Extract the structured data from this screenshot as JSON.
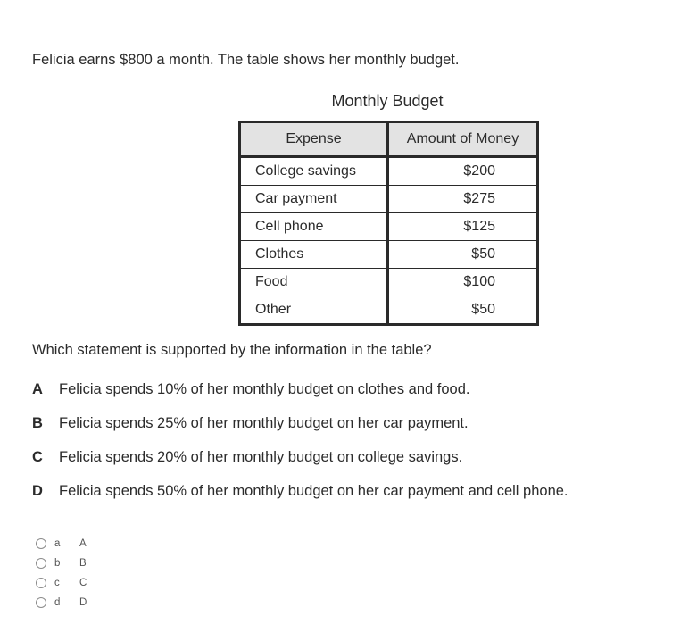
{
  "intro": "Felicia earns $800 a month. The table shows her monthly budget.",
  "table": {
    "title": "Monthly Budget",
    "headers": {
      "expense": "Expense",
      "amount": "Amount of Money"
    },
    "rows": [
      {
        "expense": "College savings",
        "amount": "$200"
      },
      {
        "expense": "Car payment",
        "amount": "$275"
      },
      {
        "expense": "Cell phone",
        "amount": "$125"
      },
      {
        "expense": "Clothes",
        "amount": "$50"
      },
      {
        "expense": "Food",
        "amount": "$100"
      },
      {
        "expense": "Other",
        "amount": "$50"
      }
    ]
  },
  "question": "Which statement is supported by the information in the table?",
  "choices": [
    {
      "letter": "A",
      "text": "Felicia spends 10% of her monthly budget on clothes and food."
    },
    {
      "letter": "B",
      "text": "Felicia spends 25% of her monthly budget on her car payment."
    },
    {
      "letter": "C",
      "text": "Felicia spends 20% of her monthly budget on college savings."
    },
    {
      "letter": "D",
      "text": "Felicia spends 50% of her monthly budget on her car payment and cell phone."
    }
  ],
  "options": [
    {
      "lower": "a",
      "upper": "A"
    },
    {
      "lower": "b",
      "upper": "B"
    },
    {
      "lower": "c",
      "upper": "C"
    },
    {
      "lower": "d",
      "upper": "D"
    }
  ]
}
